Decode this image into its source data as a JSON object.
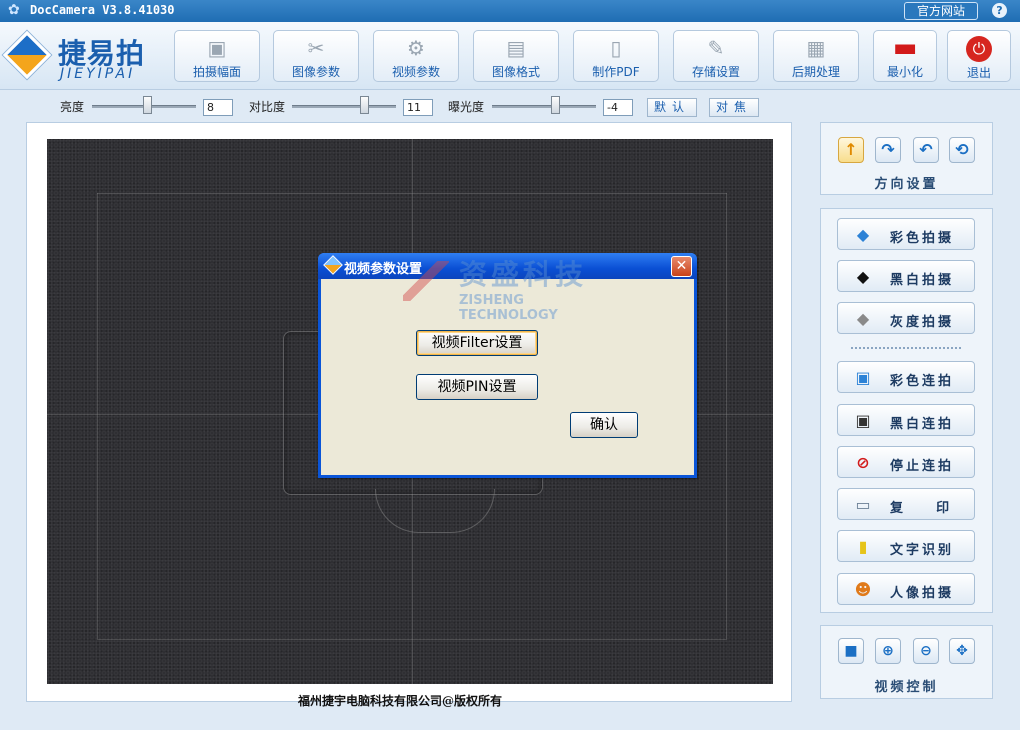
{
  "window": {
    "title": "DocCamera V3.8.41030",
    "site_button": "官方网站",
    "help_button": "?"
  },
  "logo": {
    "cn": "捷易拍",
    "en": "JIEYIPAI"
  },
  "toolbar": {
    "items": [
      {
        "label": "拍摄幅面",
        "icon": "camera-icon"
      },
      {
        "label": "图像参数",
        "icon": "tools-icon"
      },
      {
        "label": "视频参数",
        "icon": "gears-icon"
      },
      {
        "label": "图像格式",
        "icon": "images-icon"
      },
      {
        "label": "制作PDF",
        "icon": "pdf-icon"
      },
      {
        "label": "存储设置",
        "icon": "pen-icon"
      },
      {
        "label": "后期处理",
        "icon": "document-icon"
      },
      {
        "label": "最小化",
        "icon": "minimize-icon"
      },
      {
        "label": "退出",
        "icon": "power-icon"
      }
    ]
  },
  "adjust": {
    "brightness_label": "亮度",
    "brightness_value": "8",
    "brightness_level": 0.55,
    "contrast_label": "对比度",
    "contrast_value": "11",
    "contrast_level": 0.72,
    "exposure_label": "曝光度",
    "exposure_value": "-4",
    "exposure_level": 0.6,
    "default_button": "默认",
    "focus_button": "对焦"
  },
  "copyright": "福州捷宇电脑科技有限公司@版权所有",
  "direction": {
    "title": "方向设置",
    "buttons": [
      "rotate-up-icon",
      "rotate-right-icon",
      "rotate-left-icon",
      "rotate-reset-icon"
    ]
  },
  "capture": {
    "buttons": [
      {
        "label": "彩色拍摄",
        "icon": "color-diamond-icon"
      },
      {
        "label": "黑白拍摄",
        "icon": "black-diamond-icon"
      },
      {
        "label": "灰度拍摄",
        "icon": "gray-diamond-icon"
      }
    ]
  },
  "continuous": {
    "buttons": [
      {
        "label": "彩色连拍",
        "icon": "color-photo-icon"
      },
      {
        "label": "黑白连拍",
        "icon": "bw-photo-icon"
      },
      {
        "label": "停止连拍",
        "icon": "stop-icon"
      },
      {
        "label": "复    印",
        "icon": "printer-icon"
      },
      {
        "label": "文字识别",
        "icon": "text-doc-icon"
      },
      {
        "label": "人像拍摄",
        "icon": "people-icon"
      }
    ]
  },
  "video_control": {
    "title": "视频控制",
    "buttons": [
      "video-camera-icon",
      "zoom-in-icon",
      "zoom-out-icon",
      "fit-icon"
    ]
  },
  "dialog": {
    "title": "视频参数设置",
    "filter_button": "视频Filter设置",
    "pin_button": "视频PIN设置",
    "ok_button": "确认",
    "close": "✕",
    "watermark_cn": "资盛科技",
    "watermark_en": "ZISHENG TECHNOLOGY"
  },
  "colors": {
    "titlebar": "#1f6db3",
    "dialog_border": "#0a55d8",
    "accent": "#1b5fae"
  }
}
